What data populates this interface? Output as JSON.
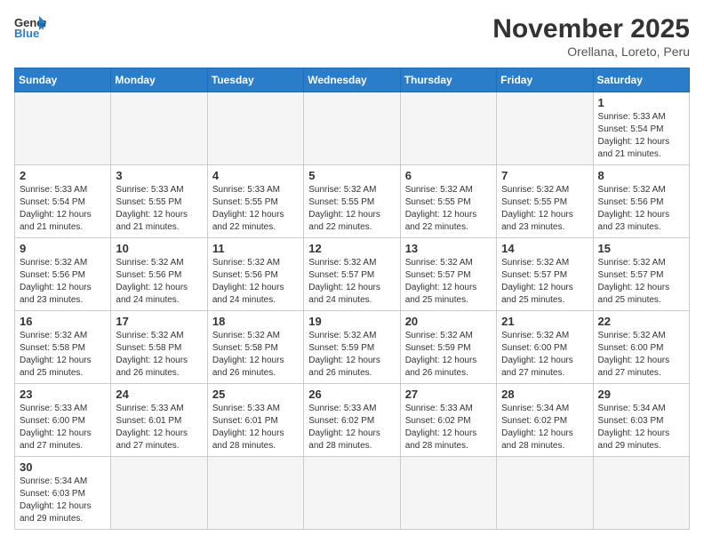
{
  "header": {
    "logo_general": "General",
    "logo_blue": "Blue",
    "title": "November 2025",
    "location": "Orellana, Loreto, Peru"
  },
  "weekdays": [
    "Sunday",
    "Monday",
    "Tuesday",
    "Wednesday",
    "Thursday",
    "Friday",
    "Saturday"
  ],
  "days": [
    {
      "date": 1,
      "sunrise": "5:33 AM",
      "sunset": "5:54 PM",
      "daylight": "12 hours and 21 minutes."
    },
    {
      "date": 2,
      "sunrise": "5:33 AM",
      "sunset": "5:54 PM",
      "daylight": "12 hours and 21 minutes."
    },
    {
      "date": 3,
      "sunrise": "5:33 AM",
      "sunset": "5:55 PM",
      "daylight": "12 hours and 21 minutes."
    },
    {
      "date": 4,
      "sunrise": "5:33 AM",
      "sunset": "5:55 PM",
      "daylight": "12 hours and 22 minutes."
    },
    {
      "date": 5,
      "sunrise": "5:32 AM",
      "sunset": "5:55 PM",
      "daylight": "12 hours and 22 minutes."
    },
    {
      "date": 6,
      "sunrise": "5:32 AM",
      "sunset": "5:55 PM",
      "daylight": "12 hours and 22 minutes."
    },
    {
      "date": 7,
      "sunrise": "5:32 AM",
      "sunset": "5:55 PM",
      "daylight": "12 hours and 23 minutes."
    },
    {
      "date": 8,
      "sunrise": "5:32 AM",
      "sunset": "5:56 PM",
      "daylight": "12 hours and 23 minutes."
    },
    {
      "date": 9,
      "sunrise": "5:32 AM",
      "sunset": "5:56 PM",
      "daylight": "12 hours and 23 minutes."
    },
    {
      "date": 10,
      "sunrise": "5:32 AM",
      "sunset": "5:56 PM",
      "daylight": "12 hours and 24 minutes."
    },
    {
      "date": 11,
      "sunrise": "5:32 AM",
      "sunset": "5:56 PM",
      "daylight": "12 hours and 24 minutes."
    },
    {
      "date": 12,
      "sunrise": "5:32 AM",
      "sunset": "5:57 PM",
      "daylight": "12 hours and 24 minutes."
    },
    {
      "date": 13,
      "sunrise": "5:32 AM",
      "sunset": "5:57 PM",
      "daylight": "12 hours and 25 minutes."
    },
    {
      "date": 14,
      "sunrise": "5:32 AM",
      "sunset": "5:57 PM",
      "daylight": "12 hours and 25 minutes."
    },
    {
      "date": 15,
      "sunrise": "5:32 AM",
      "sunset": "5:57 PM",
      "daylight": "12 hours and 25 minutes."
    },
    {
      "date": 16,
      "sunrise": "5:32 AM",
      "sunset": "5:58 PM",
      "daylight": "12 hours and 25 minutes."
    },
    {
      "date": 17,
      "sunrise": "5:32 AM",
      "sunset": "5:58 PM",
      "daylight": "12 hours and 26 minutes."
    },
    {
      "date": 18,
      "sunrise": "5:32 AM",
      "sunset": "5:58 PM",
      "daylight": "12 hours and 26 minutes."
    },
    {
      "date": 19,
      "sunrise": "5:32 AM",
      "sunset": "5:59 PM",
      "daylight": "12 hours and 26 minutes."
    },
    {
      "date": 20,
      "sunrise": "5:32 AM",
      "sunset": "5:59 PM",
      "daylight": "12 hours and 26 minutes."
    },
    {
      "date": 21,
      "sunrise": "5:32 AM",
      "sunset": "6:00 PM",
      "daylight": "12 hours and 27 minutes."
    },
    {
      "date": 22,
      "sunrise": "5:32 AM",
      "sunset": "6:00 PM",
      "daylight": "12 hours and 27 minutes."
    },
    {
      "date": 23,
      "sunrise": "5:33 AM",
      "sunset": "6:00 PM",
      "daylight": "12 hours and 27 minutes."
    },
    {
      "date": 24,
      "sunrise": "5:33 AM",
      "sunset": "6:01 PM",
      "daylight": "12 hours and 27 minutes."
    },
    {
      "date": 25,
      "sunrise": "5:33 AM",
      "sunset": "6:01 PM",
      "daylight": "12 hours and 28 minutes."
    },
    {
      "date": 26,
      "sunrise": "5:33 AM",
      "sunset": "6:02 PM",
      "daylight": "12 hours and 28 minutes."
    },
    {
      "date": 27,
      "sunrise": "5:33 AM",
      "sunset": "6:02 PM",
      "daylight": "12 hours and 28 minutes."
    },
    {
      "date": 28,
      "sunrise": "5:34 AM",
      "sunset": "6:02 PM",
      "daylight": "12 hours and 28 minutes."
    },
    {
      "date": 29,
      "sunrise": "5:34 AM",
      "sunset": "6:03 PM",
      "daylight": "12 hours and 29 minutes."
    },
    {
      "date": 30,
      "sunrise": "5:34 AM",
      "sunset": "6:03 PM",
      "daylight": "12 hours and 29 minutes."
    }
  ]
}
